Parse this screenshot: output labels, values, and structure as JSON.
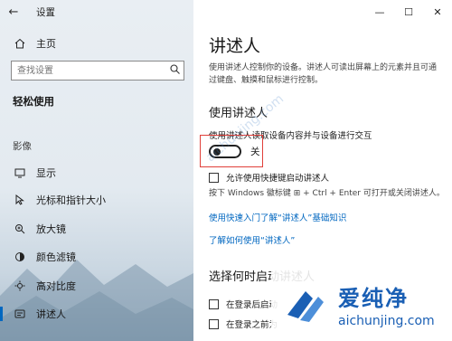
{
  "window": {
    "title": "设置"
  },
  "caption": {
    "minimize": "—",
    "maximize": "☐",
    "close": "✕"
  },
  "sidebar": {
    "home": "主页",
    "search_placeholder": "查找设置",
    "section_title": "轻松使用",
    "group_title": "影像",
    "items": [
      {
        "label": "显示",
        "icon": "monitor-icon"
      },
      {
        "label": "光标和指针大小",
        "icon": "cursor-icon"
      },
      {
        "label": "放大镜",
        "icon": "magnifier-icon"
      },
      {
        "label": "颜色滤镜",
        "icon": "color-filter-icon"
      },
      {
        "label": "高对比度",
        "icon": "contrast-icon"
      },
      {
        "label": "讲述人",
        "icon": "narrator-icon",
        "active": true
      }
    ]
  },
  "main": {
    "title": "讲述人",
    "description": "使用讲述人控制你的设备。讲述人可读出屏幕上的元素并且可通过键盘、触摸和鼠标进行控制。",
    "use_heading": "使用讲述人",
    "toggle_caption": "使用讲述人读取设备内容并与设备进行交互",
    "toggle_state": "关",
    "shortcut_checkbox": "允许使用快捷键启动讲述人",
    "shortcut_hint": "按下 Windows 徽标键 ⊞ + Ctrl + Enter 可打开或关闭讲述人。",
    "link_quickstart": "使用快速入门了解“讲述人”基础知识",
    "link_learn": "了解如何使用“讲述人”",
    "start_heading": "选择何时启动讲述人",
    "start_option_1": "在登录后启动",
    "start_option_2": "在登录之前为"
  },
  "watermark": {
    "brand_cn": "爱纯净",
    "brand_en": "aichunjing.com"
  },
  "colors": {
    "accent": "#0067c0",
    "highlight": "#e0403a",
    "brand": "#1a5fb4"
  }
}
